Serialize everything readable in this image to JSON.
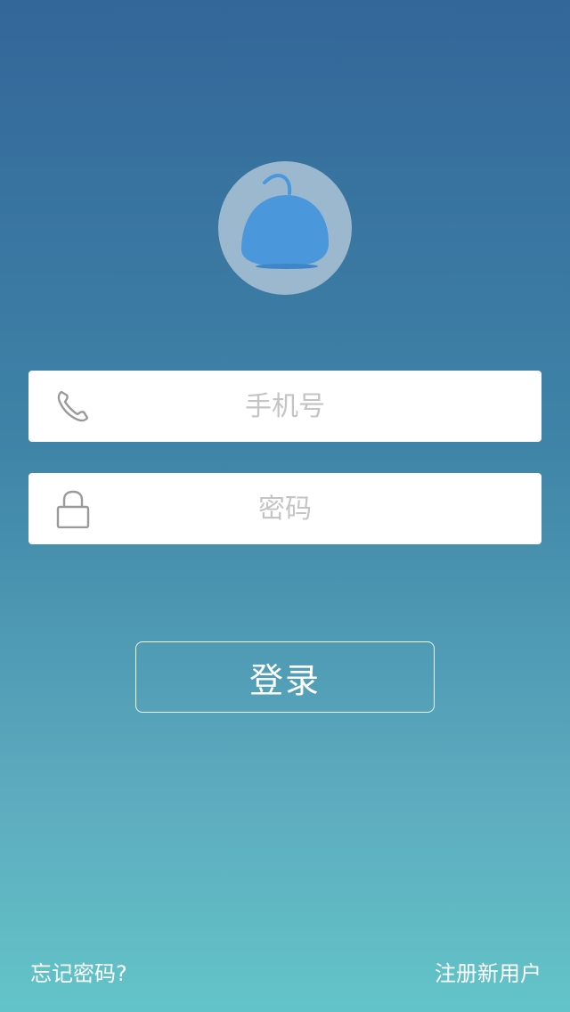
{
  "avatar": {
    "icon": "bird-mascot-icon",
    "color": "#4a97db",
    "background": "#9bb8cf"
  },
  "phone_field": {
    "icon": "phone-icon",
    "placeholder": "手机号",
    "value": ""
  },
  "password_field": {
    "icon": "lock-icon",
    "placeholder": "密码",
    "value": ""
  },
  "login_button": {
    "label": "登录"
  },
  "footer": {
    "forgot_password": "忘记密码?",
    "register": "注册新用户"
  },
  "colors": {
    "gradient_top": "#336699",
    "gradient_bottom": "#62c4c8",
    "field_background": "#ffffff",
    "placeholder": "#c4c4c4",
    "icon": "#9a9a9a"
  }
}
